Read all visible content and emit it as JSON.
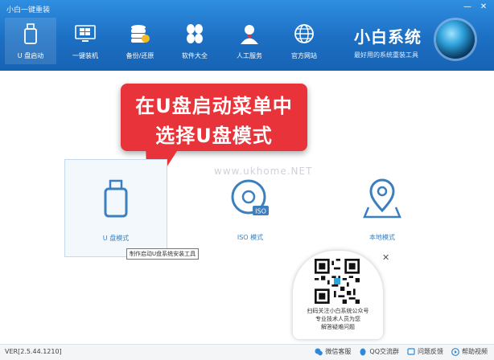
{
  "window": {
    "title": "小白一键重装"
  },
  "nav": [
    {
      "label": "U 盘启动",
      "icon": "usb-drive-icon",
      "active": true
    },
    {
      "label": "一键装机",
      "icon": "windows-icon",
      "active": false
    },
    {
      "label": "备份/还原",
      "icon": "database-backup-icon",
      "active": false
    },
    {
      "label": "软件大全",
      "icon": "clover-apps-icon",
      "active": false
    },
    {
      "label": "人工服务",
      "icon": "support-person-icon",
      "active": false
    },
    {
      "label": "官方网站",
      "icon": "globe-icon",
      "active": false
    }
  ],
  "brand": {
    "name": "小白系统",
    "slogan": "最好用的系统重装工具"
  },
  "callout": {
    "line1": "在U盘启动菜单中",
    "line2": "选择U盘模式"
  },
  "watermark": "www.ukhome.NET",
  "modes": [
    {
      "label": "U 盘模式",
      "icon": "usb-drive-icon",
      "selected": true
    },
    {
      "label": "ISO 模式",
      "icon": "iso-disc-icon",
      "selected": false
    },
    {
      "label": "本地模式",
      "icon": "location-pin-icon",
      "selected": false
    }
  ],
  "tooltip": "制作启动U盘系统安装工具",
  "qr": {
    "line1": "扫码关注小白系统公众号",
    "line2": "专业技术人员为您",
    "line3": "解答疑难问题"
  },
  "footer": {
    "version": "VER[2.5.44.1210]",
    "links": [
      {
        "label": "微信客服",
        "icon": "wechat-icon"
      },
      {
        "label": "QQ交流群",
        "icon": "qq-icon"
      },
      {
        "label": "问题反馈",
        "icon": "feedback-icon"
      },
      {
        "label": "帮助视频",
        "icon": "help-video-icon"
      }
    ]
  },
  "colors": {
    "header": "#1c6fc3",
    "accent": "#e8333a",
    "mode_text": "#3b7fbf"
  }
}
